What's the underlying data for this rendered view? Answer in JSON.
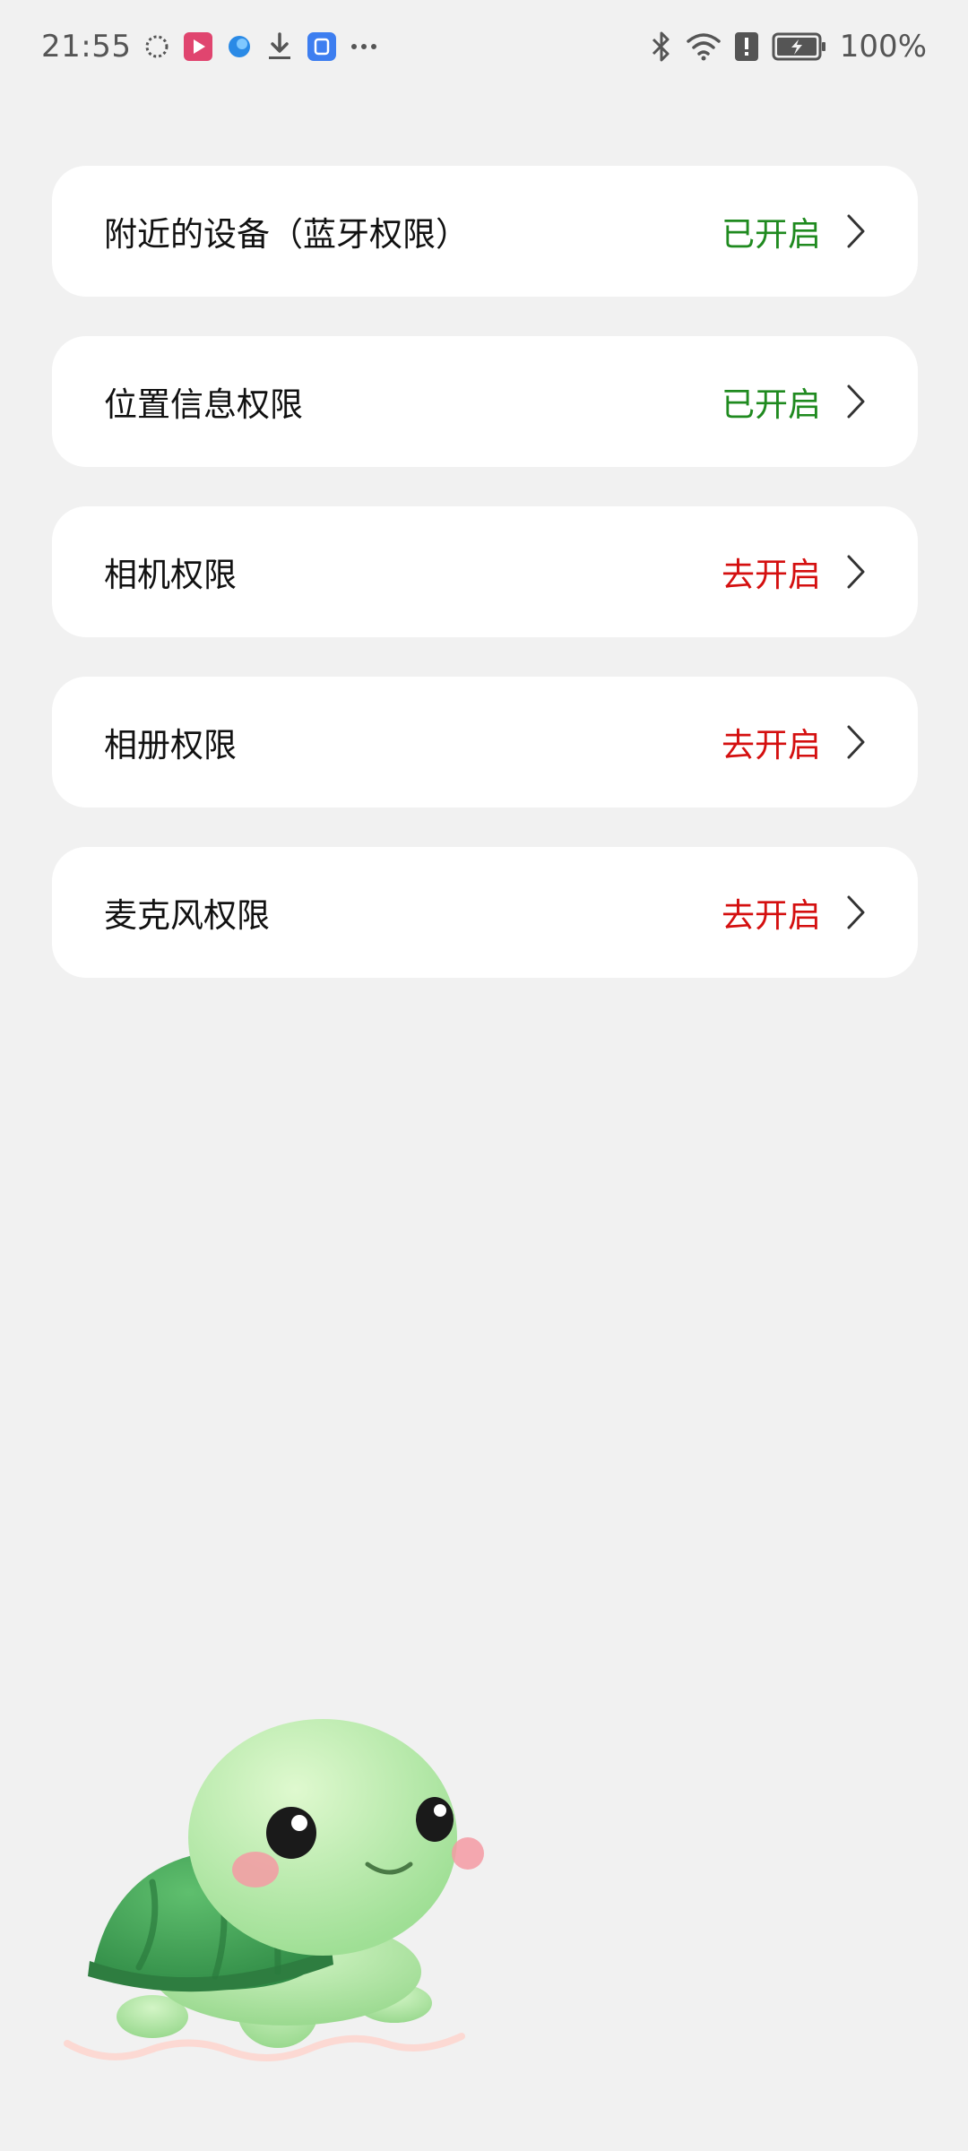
{
  "status_bar": {
    "time": "21:55",
    "battery": "100%",
    "left_icons": [
      "loading-icon",
      "video-app-icon",
      "browser-icon",
      "download-icon",
      "wallet-icon",
      "more-dots-icon"
    ],
    "right_icons": [
      "bluetooth-icon",
      "wifi-icon",
      "alert-icon",
      "battery-icon"
    ]
  },
  "permissions": [
    {
      "title": "附近的设备（蓝牙权限）",
      "status": "已开启",
      "state": "on"
    },
    {
      "title": "位置信息权限",
      "status": "已开启",
      "state": "on"
    },
    {
      "title": "相机权限",
      "status": "去开启",
      "state": "off"
    },
    {
      "title": "相册权限",
      "status": "去开启",
      "state": "off"
    },
    {
      "title": "麦克风权限",
      "status": "去开启",
      "state": "off"
    }
  ],
  "colors": {
    "on": "#1f8a1f",
    "off": "#d40f0f",
    "background": "#f1f1f1",
    "card": "#ffffff"
  }
}
